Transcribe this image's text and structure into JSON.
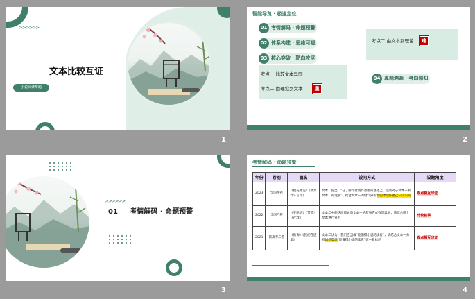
{
  "slides": [
    {
      "number": "1",
      "chevrons": ">>>>>>",
      "title": "文本比较互证",
      "badge": "小说阅读专题"
    },
    {
      "number": "2",
      "heading": "智能导览 · 极速定位",
      "items": [
        {
          "n": "01",
          "label": "考情解码 · 命题预警"
        },
        {
          "n": "02",
          "label": "体系构建 · 思维可视"
        },
        {
          "n": "03",
          "label": "核心突破 · 靶向攻坚"
        },
        {
          "n": "04",
          "label": "真题溯源 · 考向感知"
        }
      ],
      "left_points": [
        {
          "text": "考点一   比较文本异同",
          "tag": ""
        },
        {
          "text": "考点二   由理论到文本",
          "tag": "重"
        }
      ],
      "right_point": {
        "text": "考点二   由文本到理论",
        "tag": "难"
      }
    },
    {
      "number": "3",
      "chevrons": ">>>>>>",
      "section_num": "01",
      "section_title": "考情解码 · 命题预警"
    },
    {
      "number": "4",
      "heading": "考情解码 · 命题预警",
      "headers": [
        "年份",
        "卷别",
        "篇名",
        "设问方式",
        "设题角度"
      ],
      "rows": [
        {
          "year": "2023",
          "paper": "全国甲卷",
          "title": "《桃花源记》《我为什么写作》",
          "q_pre": "文本二提出：“在了解作者创作意图的基础上，谈谈对于文本一和文本二的理解”，结合文本一的材料分析",
          "q_hl": "如何体现作者这一认识的",
          "q_post": "",
          "angle": "观点相互印证"
        },
        {
          "year": "2022",
          "paper": "全国乙卷",
          "title": "《变形记》（节选）《社戏》",
          "q_pre": "文本二中的这段叙述与文本一的叙事方式有何异同，请结合两个文本进行分析",
          "q_hl": "",
          "q_post": "",
          "angle": "比较叙事"
        },
        {
          "year": "2021",
          "paper": "新高考二卷",
          "title": "《教诲》《我们在这里》",
          "q_pre": "文本二认为，我们应当做“能懂得小说的读者”，请结合文本一分析",
          "q_hl": "如何实现",
          "q_post": "“能懂得小说的读者”这一目标的",
          "angle": "观点相互印证"
        }
      ]
    }
  ],
  "colors": {
    "accent": "#3f8069",
    "mint": "#d9ece3",
    "red": "#c00000"
  }
}
